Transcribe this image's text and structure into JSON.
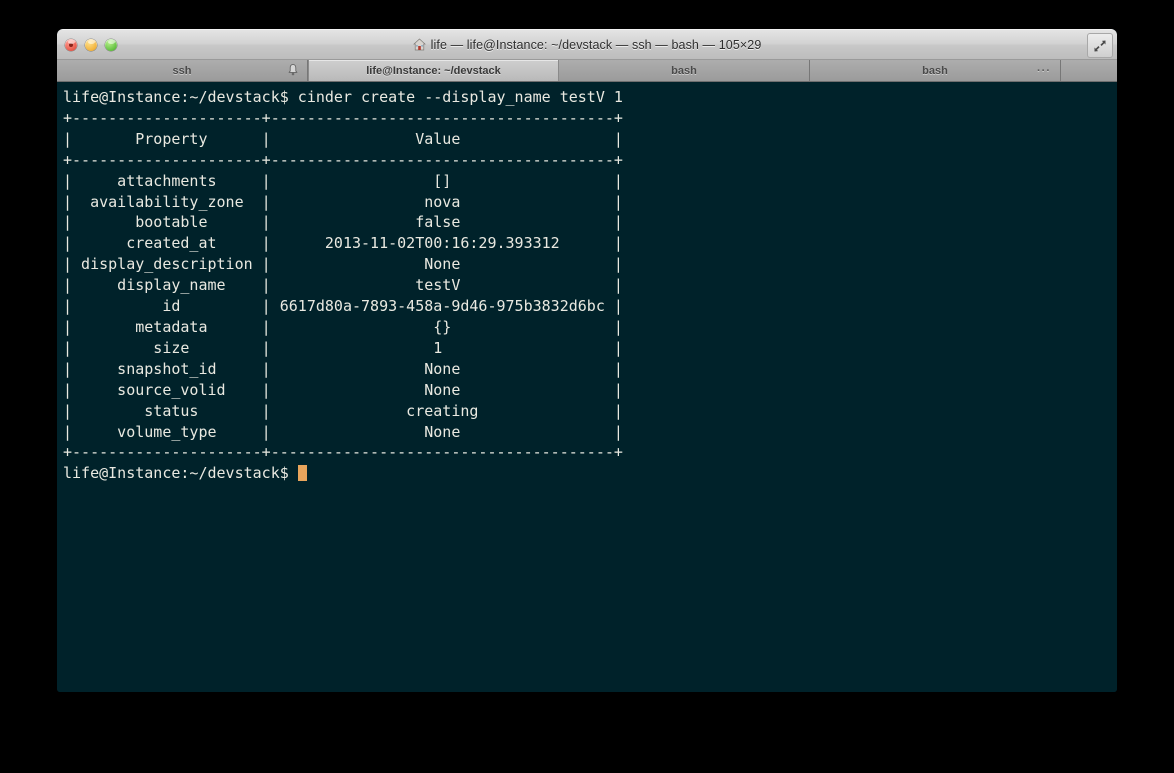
{
  "window": {
    "title": "life — life@Instance: ~/devstack — ssh — bash — 105×29",
    "home_icon": "home-icon",
    "fullscreen_icon": "fullscreen-icon",
    "traffic_lights": [
      {
        "name": "close-button",
        "color": "#e8594a"
      },
      {
        "name": "minimize-button",
        "color": "#f2b33d"
      },
      {
        "name": "zoom-button",
        "color": "#62c040"
      }
    ]
  },
  "tabs": [
    {
      "label": "ssh",
      "active": false,
      "bell_icon": "bell-icon",
      "ellipsis": ""
    },
    {
      "label": "life@Instance: ~/devstack",
      "active": true,
      "bell_icon": "",
      "ellipsis": ""
    },
    {
      "label": "bash",
      "active": false,
      "bell_icon": "",
      "ellipsis": ""
    },
    {
      "label": "bash",
      "active": false,
      "bell_icon": "",
      "ellipsis": "···"
    }
  ],
  "terminal": {
    "background_color": "#00222a",
    "text_color": "#e9e9e1",
    "cursor_color": "#e8a55c",
    "prompt": "life@Instance:~/devstack$",
    "command": "cinder create --display_name testV 1",
    "prompt_line": "life@Instance:~/devstack$ cinder create --display_name testV 1",
    "final_prompt": "life@Instance:~/devstack$ ",
    "table": {
      "headers": [
        "Property",
        "Value"
      ],
      "rows": [
        [
          "attachments",
          "[]"
        ],
        [
          "availability_zone",
          "nova"
        ],
        [
          "bootable",
          "false"
        ],
        [
          "created_at",
          "2013-11-02T00:16:29.393312"
        ],
        [
          "display_description",
          "None"
        ],
        [
          "display_name",
          "testV"
        ],
        [
          "id",
          "6617d80a-7893-458a-9d46-975b3832d6bc"
        ],
        [
          "metadata",
          "{}"
        ],
        [
          "size",
          "1"
        ],
        [
          "snapshot_id",
          "None"
        ],
        [
          "source_volid",
          "None"
        ],
        [
          "status",
          "creating"
        ],
        [
          "volume_type",
          "None"
        ]
      ]
    },
    "output": "life@Instance:~/devstack$ cinder create --display_name testV 1\n+---------------------+--------------------------------------+\n|       Property      |                Value                 |\n+---------------------+--------------------------------------+\n|     attachments     |                  []                  |\n|  availability_zone  |                 nova                 |\n|       bootable      |                false                 |\n|      created_at     |      2013-11-02T00:16:29.393312      |\n| display_description |                 None                 |\n|     display_name    |                testV                 |\n|          id         | 6617d80a-7893-458a-9d46-975b3832d6bc |\n|       metadata      |                  {}                  |\n|         size        |                  1                   |\n|     snapshot_id     |                 None                 |\n|     source_volid    |                 None                 |\n|        status       |               creating               |\n|     volume_type     |                 None                 |\n+---------------------+--------------------------------------+\n"
  }
}
